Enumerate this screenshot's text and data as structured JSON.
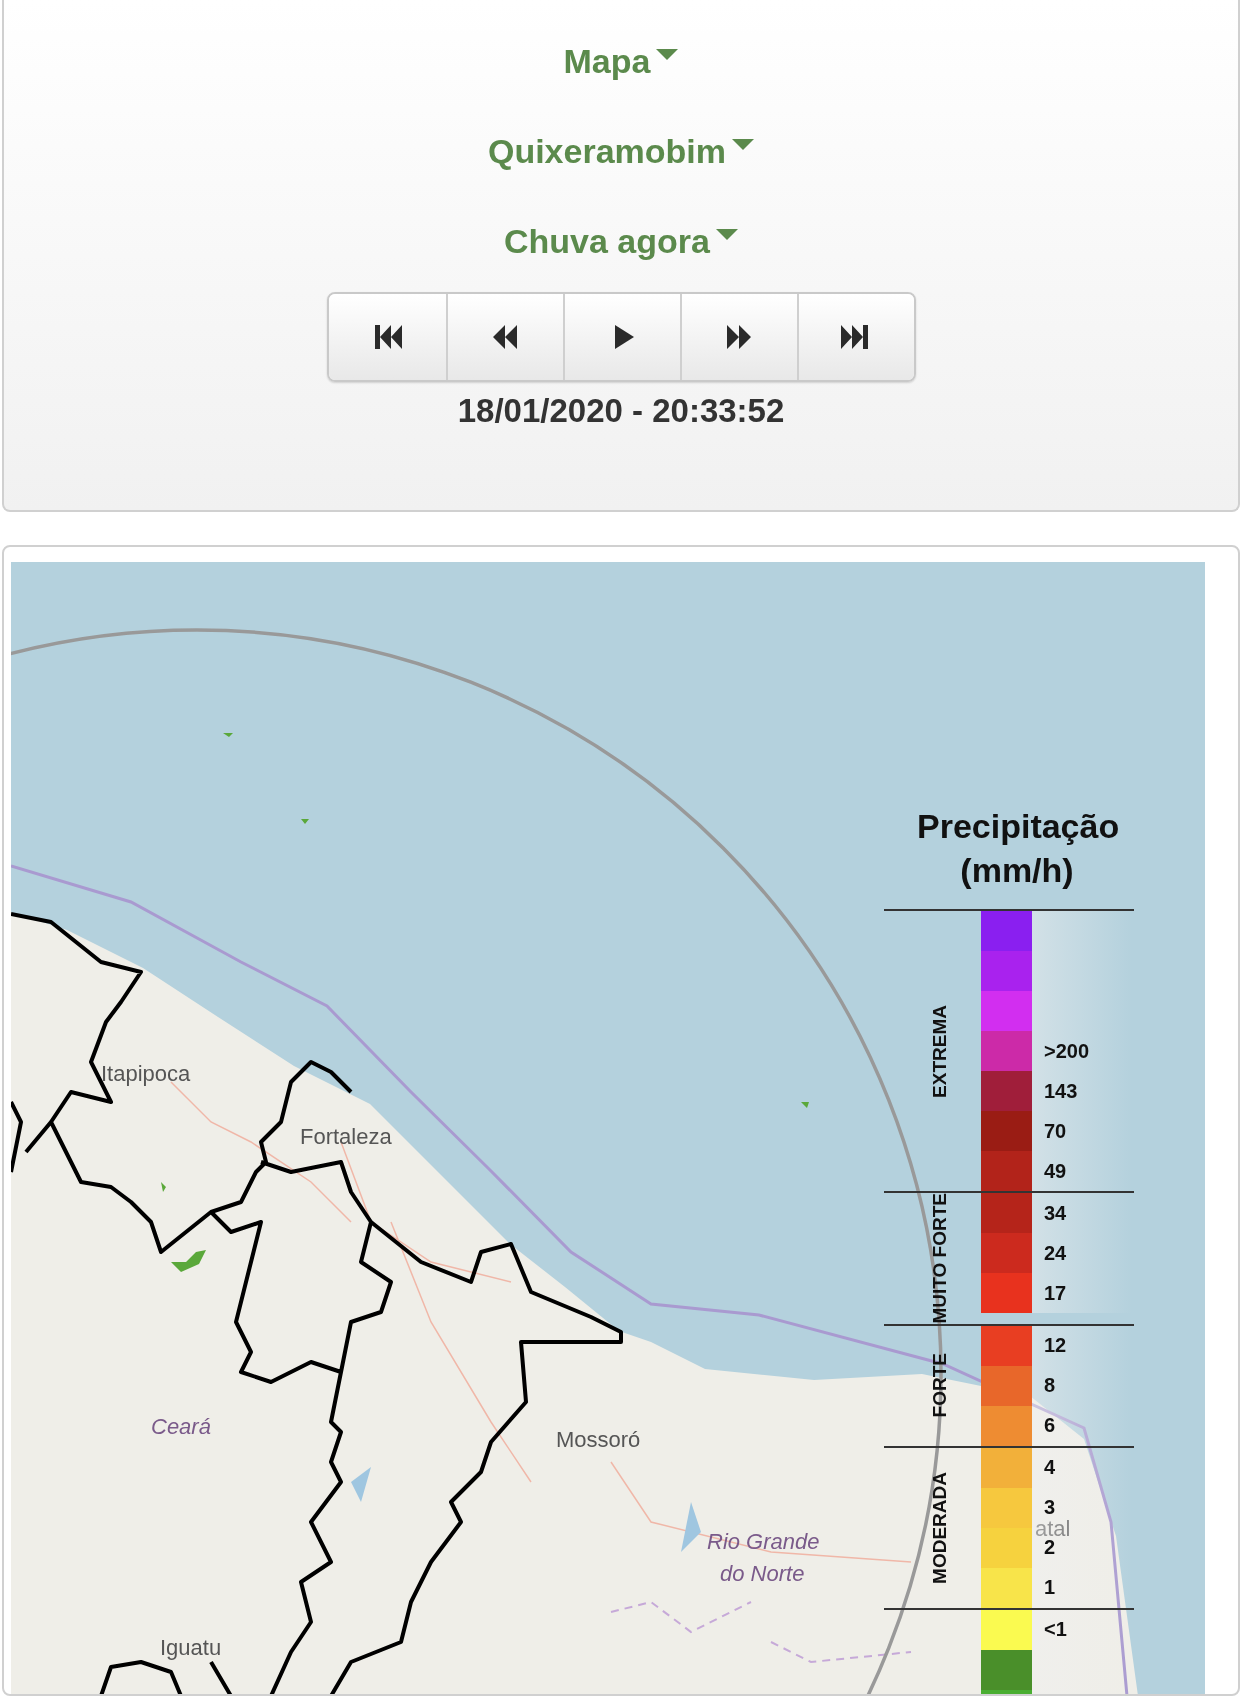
{
  "selectors": [
    {
      "label": "Mapa"
    },
    {
      "label": "Quixeramobim"
    },
    {
      "label": "Chuva agora"
    }
  ],
  "playback_buttons": [
    {
      "kind": "first"
    },
    {
      "kind": "previous"
    },
    {
      "kind": "play"
    },
    {
      "kind": "next"
    },
    {
      "kind": "last"
    }
  ],
  "timestamp": "18/01/2020 - 20:33:52",
  "map": {
    "place_labels": [
      {
        "text": "Itapipoca",
        "kind": "city"
      },
      {
        "text": "Fortaleza",
        "kind": "city"
      },
      {
        "text": "Ceará",
        "kind": "state"
      },
      {
        "text": "Mossoró",
        "kind": "city"
      },
      {
        "text": "Rio Grande",
        "kind": "state"
      },
      {
        "text": "do Norte",
        "kind": "state"
      },
      {
        "text": "Iguatu",
        "kind": "city"
      },
      {
        "text": "atal",
        "kind": "city"
      }
    ],
    "legend": {
      "title": "Precipitação (mm/h)",
      "groups": [
        {
          "label": "EXTREMA",
          "rows": [
            {
              "color": "#8a1ff0"
            },
            {
              "color": "#a922ee"
            },
            {
              "color": "#d22ef0"
            },
            {
              "color": "#cc2aa8",
              "value": ">200"
            },
            {
              "color": "#a01e3a",
              "value": "143"
            },
            {
              "color": "#9a1c14",
              "value": "70"
            },
            {
              "color": "#b2231a",
              "value": "49"
            }
          ]
        },
        {
          "label": "MUITO FORTE",
          "rows": [
            {
              "color": "#b5241a",
              "value": "34"
            },
            {
              "color": "#cc2a1e",
              "value": "24"
            },
            {
              "color": "#e8321e",
              "value": "17"
            }
          ]
        },
        {
          "label": "FORTE",
          "rows": [
            {
              "color": "#e83e22",
              "value": "12"
            },
            {
              "color": "#e8672a",
              "value": "8"
            },
            {
              "color": "#ee8c32",
              "value": "6"
            }
          ]
        },
        {
          "label": "MODERADA",
          "rows": [
            {
              "color": "#f2b03a",
              "value": "4"
            },
            {
              "color": "#f6c83e",
              "value": "3"
            },
            {
              "color": "#f6d23e",
              "value": "2"
            },
            {
              "color": "#f8e44a",
              "value": "1"
            }
          ]
        },
        {
          "rows": [
            {
              "color": "#fafa50",
              "value": "<1"
            },
            {
              "color": "#4a8f2a"
            },
            {
              "color": "#4aae32"
            }
          ]
        }
      ]
    }
  }
}
